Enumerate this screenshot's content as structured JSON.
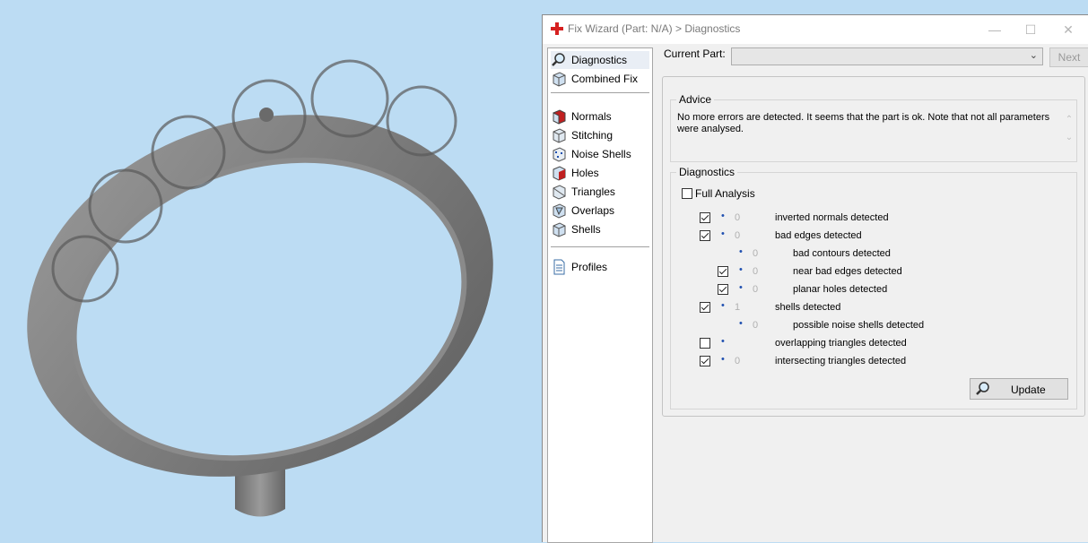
{
  "window": {
    "title": "Fix Wizard (Part: N/A) > Diagnostics",
    "controls": {
      "minimize": "—",
      "maximize": "☐",
      "close": "✕"
    }
  },
  "nav": {
    "top_items": [
      {
        "label": "Diagnostics",
        "icon": "magnifier-icon",
        "selected": true
      },
      {
        "label": "Combined Fix",
        "icon": "cube-icon"
      }
    ],
    "fix_items": [
      {
        "label": "Normals",
        "icon": "normals-icon"
      },
      {
        "label": "Stitching",
        "icon": "stitching-icon"
      },
      {
        "label": "Noise Shells",
        "icon": "noise-shells-icon"
      },
      {
        "label": "Holes",
        "icon": "holes-icon"
      },
      {
        "label": "Triangles",
        "icon": "triangles-icon"
      },
      {
        "label": "Overlaps",
        "icon": "overlaps-icon"
      },
      {
        "label": "Shells",
        "icon": "shells-icon"
      }
    ],
    "bottom_items": [
      {
        "label": "Profiles",
        "icon": "profile-document-icon"
      }
    ]
  },
  "toolbar": {
    "current_part_label": "Current Part:",
    "current_part_value": "",
    "next_label": "Next"
  },
  "advice": {
    "title": "Advice",
    "text": "No more errors are detected. It seems that the part is ok. Note that not all parameters were analysed."
  },
  "diagnostics": {
    "title": "Diagnostics",
    "full_analysis_label": "Full Analysis",
    "full_analysis_checked": false,
    "rows": [
      {
        "checked": true,
        "has_checkbox": true,
        "count": "0",
        "label": "inverted normals detected",
        "level": 0
      },
      {
        "checked": true,
        "has_checkbox": true,
        "count": "0",
        "label": "bad edges detected",
        "level": 0
      },
      {
        "checked": false,
        "has_checkbox": false,
        "count": "0",
        "label": "bad contours detected",
        "level": 1
      },
      {
        "checked": true,
        "has_checkbox": true,
        "count": "0",
        "label": "near bad edges detected",
        "level": 1
      },
      {
        "checked": true,
        "has_checkbox": true,
        "count": "0",
        "label": "planar holes detected",
        "level": 1
      },
      {
        "checked": true,
        "has_checkbox": true,
        "count": "1",
        "label": "shells detected",
        "level": 0
      },
      {
        "checked": false,
        "has_checkbox": false,
        "count": "0",
        "label": "possible noise shells detected",
        "level": 1
      },
      {
        "checked": false,
        "has_checkbox": true,
        "count": "",
        "label": "overlapping triangles detected",
        "level": 0
      },
      {
        "checked": true,
        "has_checkbox": true,
        "count": "0",
        "label": "intersecting triangles detected",
        "level": 0
      }
    ],
    "update_label": "Update"
  },
  "colors": {
    "viewport_background": "#bcdcf3",
    "model_gray": "#7f7f7f",
    "bullet_blue": "#2050b0",
    "brand_red": "#d62020"
  }
}
